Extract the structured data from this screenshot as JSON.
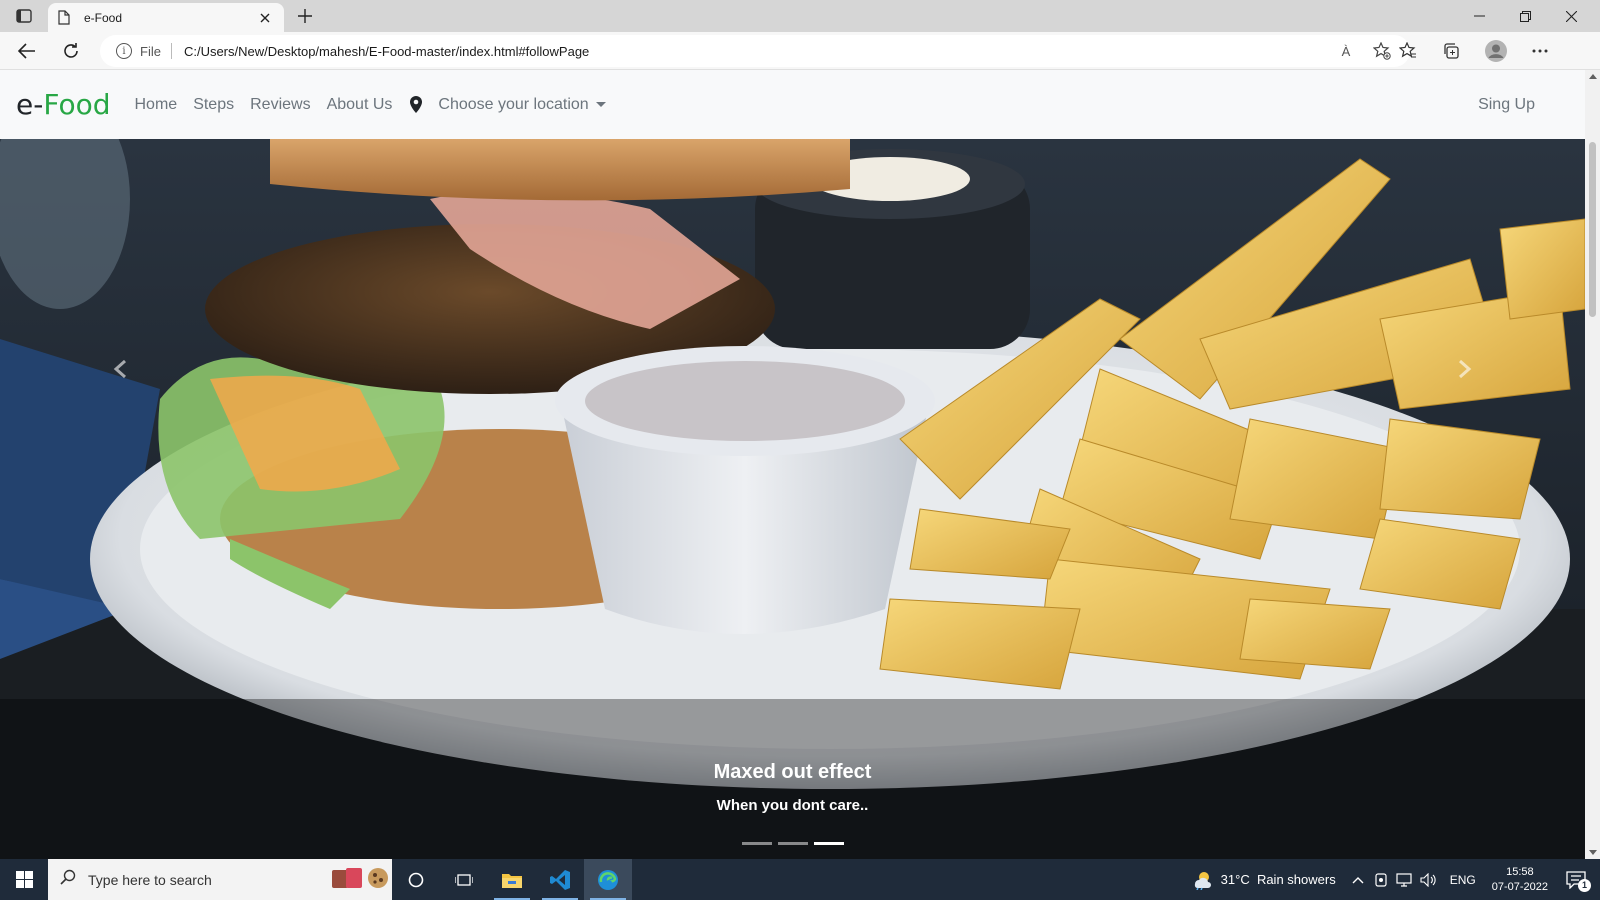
{
  "browser": {
    "tab_title": "e-Food",
    "address_scheme": "File",
    "url": "C:/Users/New/Desktop/mahesh/E-Food-master/index.html#followPage",
    "read_aloud_glyph": "À"
  },
  "site": {
    "brand_prefix": "e-",
    "brand_accent": "Food",
    "brand_accent_color": "#28a745",
    "nav": [
      "Home",
      "Steps",
      "Reviews",
      "About Us"
    ],
    "location_dropdown": "Choose your location",
    "signup": "Sing Up"
  },
  "hero": {
    "caption_title": "Maxed out effect",
    "caption_text": "When you dont care..",
    "slides": 3,
    "active_slide": 3
  },
  "taskbar": {
    "search_placeholder": "Type here to search",
    "weather": "31°C  Rain showers",
    "language": "ENG",
    "time": "15:58",
    "date": "07-07-2022",
    "notification_count": "1"
  }
}
